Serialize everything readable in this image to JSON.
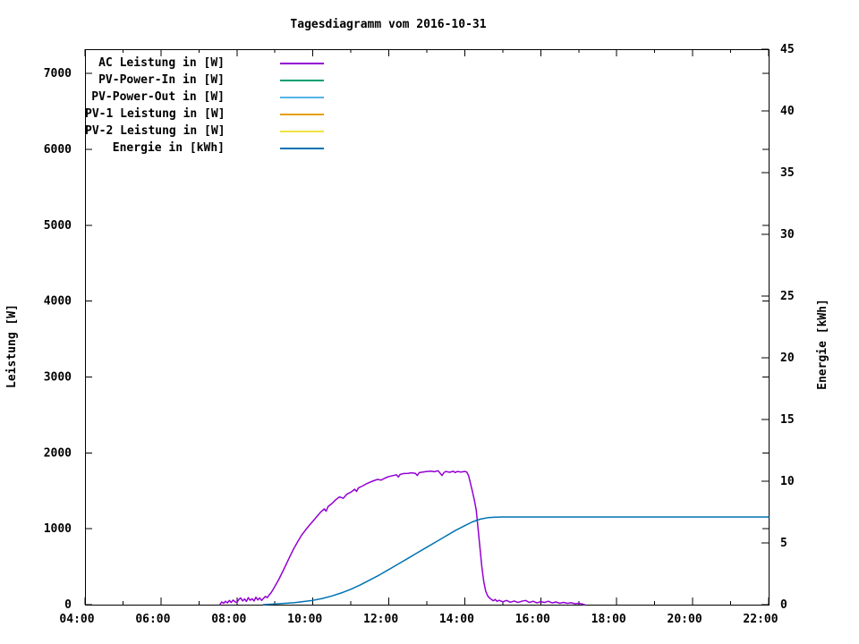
{
  "chart_data": {
    "type": "line",
    "title": "Tagesdiagramm vom 2016-10-31",
    "background": "#ffffff",
    "legend_position": "top-left-inside",
    "grid": false,
    "x_axis": {
      "range": [
        4,
        22
      ],
      "ticks": [
        {
          "h": 4,
          "label": "04:00"
        },
        {
          "h": 6,
          "label": "06:00"
        },
        {
          "h": 8,
          "label": "08:00"
        },
        {
          "h": 10,
          "label": "10:00"
        },
        {
          "h": 12,
          "label": "12:00"
        },
        {
          "h": 14,
          "label": "14:00"
        },
        {
          "h": 16,
          "label": "16:00"
        },
        {
          "h": 18,
          "label": "18:00"
        },
        {
          "h": 20,
          "label": "20:00"
        },
        {
          "h": 22,
          "label": "22:00"
        }
      ],
      "minor_hours": [
        5,
        7,
        9,
        11,
        13,
        15,
        17,
        19,
        21
      ]
    },
    "y_left": {
      "label": "Leistung [W]",
      "range": [
        0,
        7320
      ],
      "ticks": [
        {
          "v": 0,
          "label": "0"
        },
        {
          "v": 1000,
          "label": "1000"
        },
        {
          "v": 2000,
          "label": "2000"
        },
        {
          "v": 3000,
          "label": "3000"
        },
        {
          "v": 4000,
          "label": "4000"
        },
        {
          "v": 5000,
          "label": "5000"
        },
        {
          "v": 6000,
          "label": "6000"
        },
        {
          "v": 7000,
          "label": "7000"
        }
      ]
    },
    "y_right": {
      "label": "Energie [kWh]",
      "range": [
        0,
        45
      ],
      "ticks": [
        {
          "v": 0,
          "label": "0"
        },
        {
          "v": 5,
          "label": "5"
        },
        {
          "v": 10,
          "label": "10"
        },
        {
          "v": 15,
          "label": "15"
        },
        {
          "v": 20,
          "label": "20"
        },
        {
          "v": 25,
          "label": "25"
        },
        {
          "v": 30,
          "label": "30"
        },
        {
          "v": 35,
          "label": "35"
        },
        {
          "v": 40,
          "label": "40"
        },
        {
          "v": 45,
          "label": "45"
        }
      ]
    },
    "series": [
      {
        "name": "AC Leistung in [W]",
        "color": "#9400d3",
        "axis": "left",
        "points": [
          [
            7.55,
            0
          ],
          [
            7.6,
            35
          ],
          [
            7.65,
            18
          ],
          [
            7.7,
            45
          ],
          [
            7.75,
            22
          ],
          [
            7.8,
            55
          ],
          [
            7.85,
            28
          ],
          [
            7.9,
            60
          ],
          [
            7.95,
            38
          ],
          [
            8.0,
            28
          ],
          [
            8.05,
            70
          ],
          [
            8.1,
            88
          ],
          [
            8.15,
            48
          ],
          [
            8.2,
            75
          ],
          [
            8.25,
            42
          ],
          [
            8.3,
            92
          ],
          [
            8.35,
            58
          ],
          [
            8.4,
            78
          ],
          [
            8.45,
            48
          ],
          [
            8.5,
            98
          ],
          [
            8.55,
            62
          ],
          [
            8.6,
            88
          ],
          [
            8.65,
            55
          ],
          [
            8.7,
            82
          ],
          [
            8.75,
            108
          ],
          [
            8.8,
            92
          ],
          [
            8.85,
            128
          ],
          [
            8.9,
            158
          ],
          [
            8.95,
            198
          ],
          [
            9.0,
            240
          ],
          [
            9.1,
            330
          ],
          [
            9.2,
            430
          ],
          [
            9.3,
            535
          ],
          [
            9.4,
            640
          ],
          [
            9.5,
            740
          ],
          [
            9.6,
            830
          ],
          [
            9.7,
            912
          ],
          [
            9.8,
            980
          ],
          [
            9.9,
            1042
          ],
          [
            10.0,
            1100
          ],
          [
            10.1,
            1158
          ],
          [
            10.2,
            1218
          ],
          [
            10.3,
            1262
          ],
          [
            10.35,
            1232
          ],
          [
            10.4,
            1292
          ],
          [
            10.5,
            1332
          ],
          [
            10.6,
            1382
          ],
          [
            10.7,
            1420
          ],
          [
            10.8,
            1402
          ],
          [
            10.9,
            1458
          ],
          [
            11.0,
            1482
          ],
          [
            11.1,
            1520
          ],
          [
            11.15,
            1492
          ],
          [
            11.2,
            1540
          ],
          [
            11.3,
            1562
          ],
          [
            11.4,
            1590
          ],
          [
            11.5,
            1612
          ],
          [
            11.6,
            1632
          ],
          [
            11.7,
            1650
          ],
          [
            11.8,
            1642
          ],
          [
            11.9,
            1668
          ],
          [
            12.0,
            1688
          ],
          [
            12.1,
            1700
          ],
          [
            12.2,
            1712
          ],
          [
            12.25,
            1682
          ],
          [
            12.3,
            1718
          ],
          [
            12.4,
            1728
          ],
          [
            12.5,
            1730
          ],
          [
            12.6,
            1738
          ],
          [
            12.7,
            1730
          ],
          [
            12.75,
            1702
          ],
          [
            12.8,
            1740
          ],
          [
            12.9,
            1748
          ],
          [
            13.0,
            1755
          ],
          [
            13.1,
            1760
          ],
          [
            13.2,
            1752
          ],
          [
            13.3,
            1765
          ],
          [
            13.35,
            1732
          ],
          [
            13.4,
            1702
          ],
          [
            13.45,
            1740
          ],
          [
            13.5,
            1755
          ],
          [
            13.6,
            1745
          ],
          [
            13.7,
            1758
          ],
          [
            13.75,
            1740
          ],
          [
            13.8,
            1755
          ],
          [
            13.9,
            1748
          ],
          [
            14.0,
            1755
          ],
          [
            14.05,
            1748
          ],
          [
            14.1,
            1700
          ],
          [
            14.15,
            1598
          ],
          [
            14.2,
            1495
          ],
          [
            14.25,
            1380
          ],
          [
            14.3,
            1248
          ],
          [
            14.35,
            1000
          ],
          [
            14.4,
            748
          ],
          [
            14.45,
            498
          ],
          [
            14.5,
            298
          ],
          [
            14.55,
            178
          ],
          [
            14.6,
            118
          ],
          [
            14.65,
            88
          ],
          [
            14.7,
            68
          ],
          [
            14.75,
            52
          ],
          [
            14.8,
            68
          ],
          [
            14.85,
            42
          ],
          [
            14.9,
            58
          ],
          [
            15.0,
            38
          ],
          [
            15.1,
            55
          ],
          [
            15.2,
            32
          ],
          [
            15.3,
            48
          ],
          [
            15.4,
            28
          ],
          [
            15.5,
            45
          ],
          [
            15.6,
            55
          ],
          [
            15.7,
            28
          ],
          [
            15.8,
            45
          ],
          [
            15.9,
            22
          ],
          [
            16.0,
            40
          ],
          [
            16.1,
            28
          ],
          [
            16.2,
            45
          ],
          [
            16.3,
            22
          ],
          [
            16.4,
            35
          ],
          [
            16.5,
            18
          ],
          [
            16.6,
            30
          ],
          [
            16.7,
            18
          ],
          [
            16.8,
            25
          ],
          [
            16.9,
            12
          ],
          [
            17.0,
            18
          ],
          [
            17.1,
            8
          ],
          [
            17.15,
            0
          ]
        ]
      },
      {
        "name": "PV-Power-In in [W]",
        "color": "#009e73",
        "axis": "left",
        "points": []
      },
      {
        "name": "PV-Power-Out in [W]",
        "color": "#56b4e9",
        "axis": "left",
        "points": []
      },
      {
        "name": "PV-1 Leistung in [W]",
        "color": "#e69f00",
        "axis": "left",
        "points": []
      },
      {
        "name": "PV-2 Leistung in [W]",
        "color": "#f0e442",
        "axis": "left",
        "points": []
      },
      {
        "name": "Energie in [kWh]",
        "color": "#0072b2",
        "axis": "right",
        "points": [
          [
            8.7,
            0.0
          ],
          [
            9.0,
            0.05
          ],
          [
            9.5,
            0.15
          ],
          [
            10.0,
            0.35
          ],
          [
            10.25,
            0.5
          ],
          [
            10.5,
            0.7
          ],
          [
            10.75,
            0.95
          ],
          [
            11.0,
            1.25
          ],
          [
            11.25,
            1.6
          ],
          [
            11.5,
            2.0
          ],
          [
            11.75,
            2.4
          ],
          [
            12.0,
            2.85
          ],
          [
            12.25,
            3.3
          ],
          [
            12.5,
            3.75
          ],
          [
            12.75,
            4.2
          ],
          [
            13.0,
            4.65
          ],
          [
            13.25,
            5.1
          ],
          [
            13.5,
            5.55
          ],
          [
            13.75,
            6.0
          ],
          [
            14.0,
            6.4
          ],
          [
            14.2,
            6.7
          ],
          [
            14.4,
            6.92
          ],
          [
            14.6,
            7.04
          ],
          [
            14.8,
            7.09
          ],
          [
            15.0,
            7.1
          ],
          [
            16.0,
            7.1
          ],
          [
            18.0,
            7.1
          ],
          [
            20.0,
            7.1
          ],
          [
            22.0,
            7.1
          ]
        ]
      }
    ]
  }
}
